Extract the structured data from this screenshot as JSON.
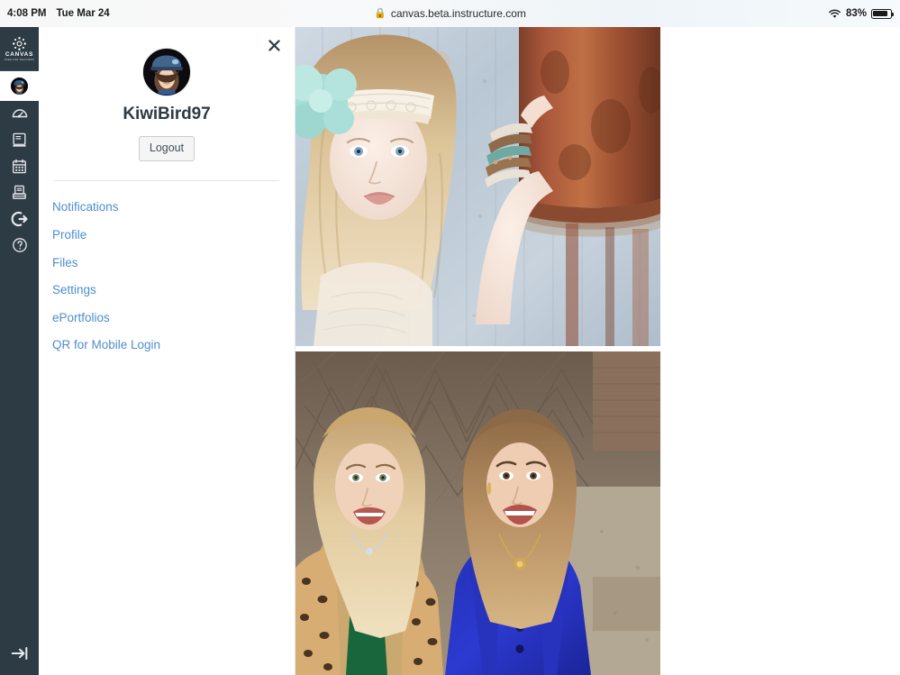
{
  "status_bar": {
    "time": "4:08 PM",
    "date": "Tue Mar 24",
    "url": "canvas.beta.instructure.com",
    "lock_icon": "lock-icon",
    "wifi_icon": "wifi-icon",
    "battery_percent": "83%",
    "battery_level": 83,
    "battery_icon": "battery-icon"
  },
  "global_nav": {
    "logo": {
      "icon": "canvas-logo-icon",
      "wordmark": "CANVAS",
      "tagline": "FREE FOR TEACHERS"
    },
    "account_avatar": "user-avatar",
    "items": [
      {
        "name": "dashboard",
        "icon": "dashboard-icon"
      },
      {
        "name": "courses",
        "icon": "courses-book-icon"
      },
      {
        "name": "calendar",
        "icon": "calendar-icon"
      },
      {
        "name": "inbox",
        "icon": "inbox-tray-icon"
      },
      {
        "name": "logout",
        "icon": "logout-arrow-icon"
      },
      {
        "name": "help",
        "icon": "help-question-icon"
      }
    ],
    "collapse": {
      "name": "collapse-nav",
      "icon": "arrow-to-line-icon"
    }
  },
  "tray": {
    "close_icon": "close-icon",
    "avatar": "user-avatar",
    "user_name": "KiwiBird97",
    "logout_label": "Logout",
    "links": [
      {
        "label": "Notifications"
      },
      {
        "label": "Profile"
      },
      {
        "label": "Files"
      },
      {
        "label": "Settings"
      },
      {
        "label": "ePortfolios"
      },
      {
        "label": "QR for Mobile Login"
      }
    ]
  },
  "content": {
    "photos": [
      {
        "name": "photo-girl-with-lace-headband",
        "description": "Portrait of a blonde girl wearing a white lace headband with a mint-green flower, arm raised, standing beside a rusted metal barrel against a weathered corrugated metal wall."
      },
      {
        "name": "photo-two-women-outdoors",
        "description": "Two smiling women seated outdoors in front of bare winter branches; the left woman wears a leopard-print coat over a green top, the right woman wears a royal blue blazer over a white top with a gold pendant necklace."
      }
    ]
  },
  "colors": {
    "nav_background": "#2d3b45",
    "link_blue": "#4d8ece",
    "text_dark": "#2d3b45",
    "divider": "#e3e5e7",
    "button_face": "#f5f5f5",
    "page_background": "#ffffff"
  }
}
